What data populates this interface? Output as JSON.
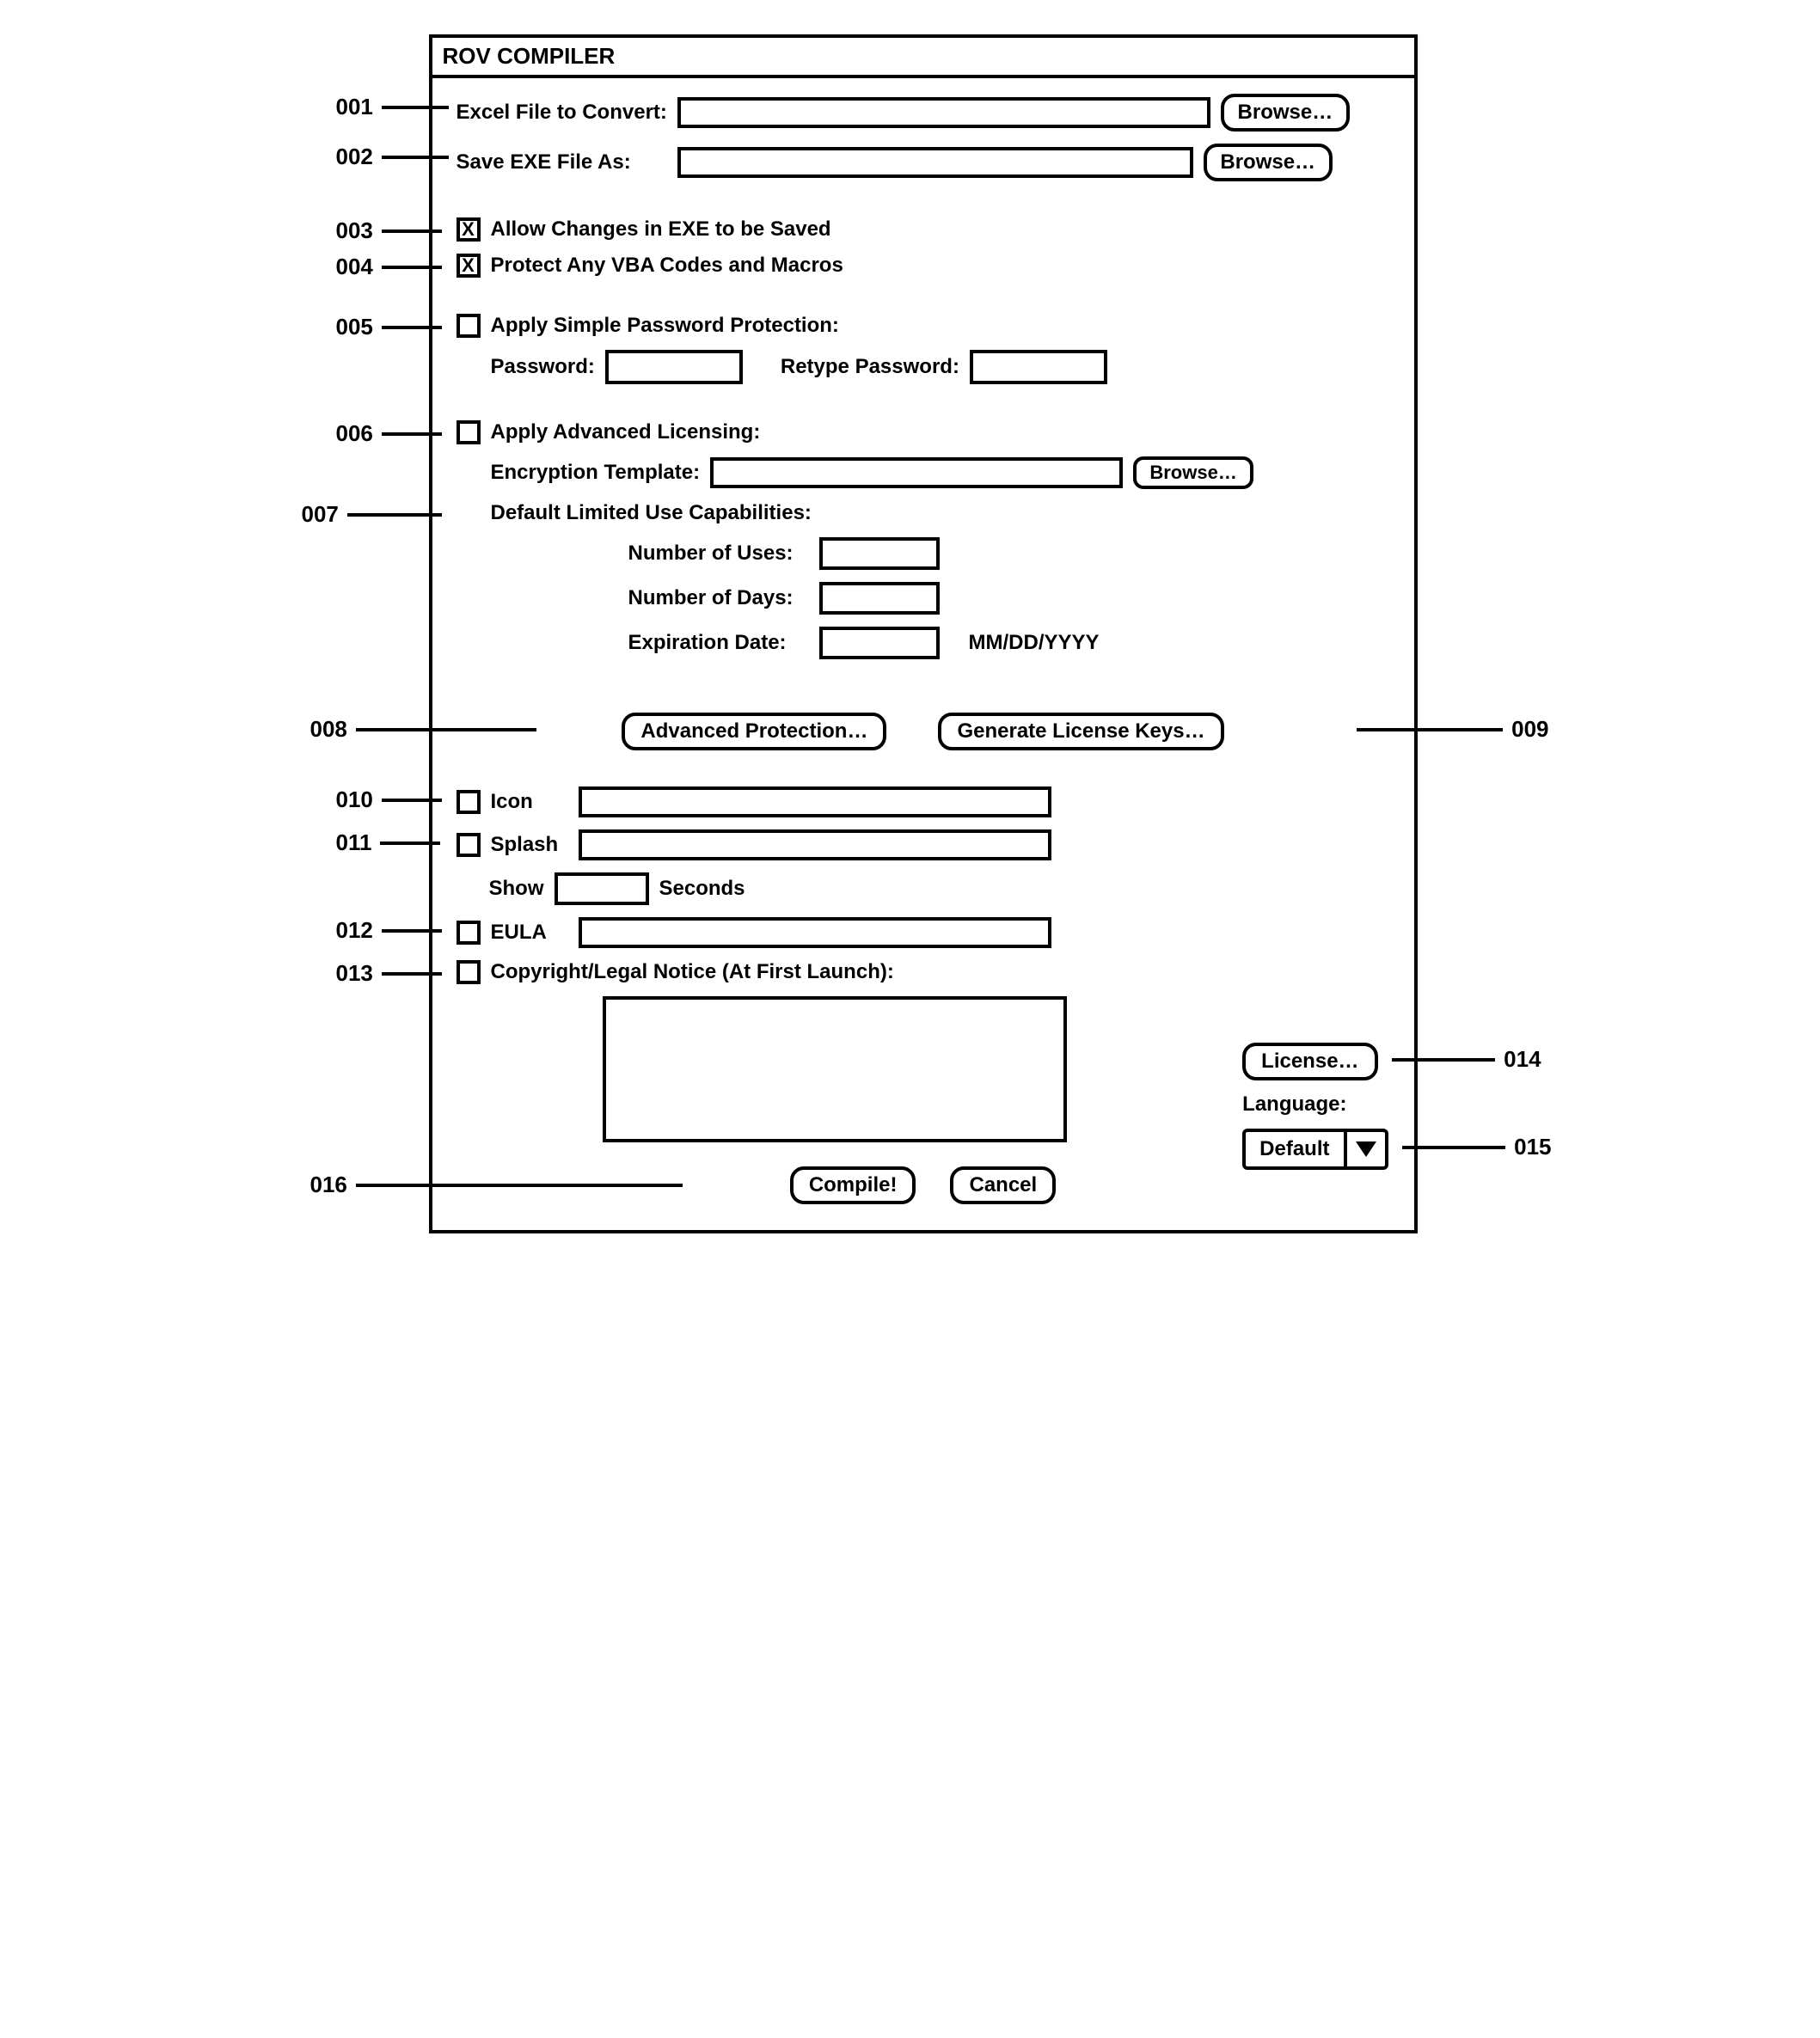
{
  "window_title": "ROV COMPILER",
  "refs": {
    "r001": "001",
    "r002": "002",
    "r003": "003",
    "r004": "004",
    "r005": "005",
    "r006": "006",
    "r007": "007",
    "r008": "008",
    "r009": "009",
    "r010": "010",
    "r011": "011",
    "r012": "012",
    "r013": "013",
    "r014": "014",
    "r015": "015",
    "r016": "016"
  },
  "labels": {
    "excel_file": "Excel File to Convert:",
    "save_exe": "Save EXE File As:",
    "allow_changes": "Allow Changes in EXE to be Saved",
    "protect_vba": "Protect Any VBA Codes and Macros",
    "simple_pw": "Apply Simple Password Protection:",
    "password": "Password:",
    "retype_password": "Retype Password:",
    "adv_license": "Apply Advanced Licensing:",
    "encryption_template": "Encryption Template:",
    "default_limited": "Default Limited Use Capabilities:",
    "num_uses": "Number of Uses:",
    "num_days": "Number of Days:",
    "exp_date": "Expiration Date:",
    "date_format": "MM/DD/YYYY",
    "icon": "Icon",
    "splash": "Splash",
    "show": "Show",
    "seconds": "Seconds",
    "eula": "EULA",
    "copyright": "Copyright/Legal Notice (At First Launch):",
    "language": "Language:"
  },
  "buttons": {
    "browse": "Browse…",
    "adv_protection": "Advanced Protection…",
    "gen_keys": "Generate License Keys…",
    "license": "License…",
    "compile": "Compile!",
    "cancel": "Cancel"
  },
  "values": {
    "language_selected": "Default"
  }
}
